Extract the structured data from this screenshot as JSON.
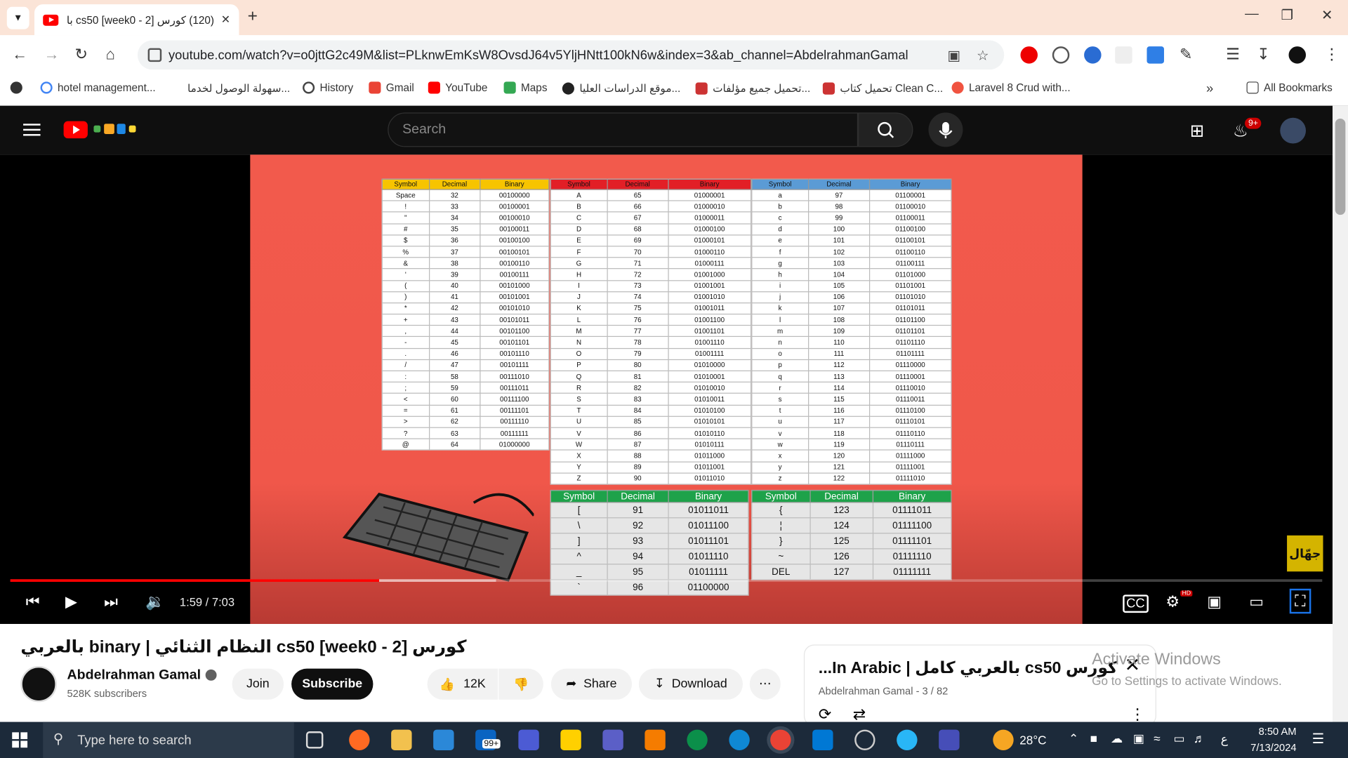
{
  "browser": {
    "tab_title": "(120) كورس cs50 [week0 - 2] بال",
    "url": "youtube.com/watch?v=o0jttG2c49M&list=PLknwEmKsW8OvsdJ64v5YljHNtt100kN6w&index=3&ab_channel=AbdelrahmanGamal",
    "bookmarks": [
      "hotel management...",
      "سهولة الوصول لخدما...",
      "History",
      "Gmail",
      "YouTube",
      "Maps",
      "موقع الدراسات العليا...",
      "تحميل جميع مؤلفات...",
      "تحميل كتاب Clean C...",
      "Laravel 8 Crud with..."
    ],
    "all_bookmarks_label": "All Bookmarks"
  },
  "youtube": {
    "search_placeholder": "Search",
    "notification_count": "9+",
    "hd_badge": "HD",
    "player": {
      "current_time": "1:59",
      "duration": "7:03",
      "time_display": "1:59 / 7:03",
      "played_fraction": 0.281,
      "loaded_fraction": 0.37,
      "watermark": "جهّال"
    },
    "video_title": "كورس cs50 [week0 - 2] النظام الثنائي | binary بالعربي",
    "channel": {
      "name": "Abdelrahman Gamal",
      "subscribers": "528K subscribers"
    },
    "buttons": {
      "join": "Join",
      "subscribe": "Subscribe",
      "likes": "12K",
      "share": "Share",
      "download": "Download"
    },
    "playlist": {
      "title": "كورس cs50 بالعربي كامل | In Arabic...",
      "subtitle": "Abdelrahman Gamal - 3 / 82"
    },
    "activate_windows": {
      "title": "Activate Windows",
      "subtitle": "Go to Settings to activate Windows."
    }
  },
  "ascii_tables": {
    "headers": [
      "Symbol",
      "Decimal",
      "Binary"
    ],
    "symbols_table": [
      [
        "Space",
        "32",
        "00100000"
      ],
      [
        "!",
        "33",
        "00100001"
      ],
      [
        "\"",
        "34",
        "00100010"
      ],
      [
        "#",
        "35",
        "00100011"
      ],
      [
        "$",
        "36",
        "00100100"
      ],
      [
        "%",
        "37",
        "00100101"
      ],
      [
        "&",
        "38",
        "00100110"
      ],
      [
        "'",
        "39",
        "00100111"
      ],
      [
        "(",
        "40",
        "00101000"
      ],
      [
        ")",
        "41",
        "00101001"
      ],
      [
        "*",
        "42",
        "00101010"
      ],
      [
        "+",
        "43",
        "00101011"
      ],
      [
        ",",
        "44",
        "00101100"
      ],
      [
        "-",
        "45",
        "00101101"
      ],
      [
        ".",
        "46",
        "00101110"
      ],
      [
        "/",
        "47",
        "00101111"
      ],
      [
        ":",
        "58",
        "00111010"
      ],
      [
        ";",
        "59",
        "00111011"
      ],
      [
        "<",
        "60",
        "00111100"
      ],
      [
        "=",
        "61",
        "00111101"
      ],
      [
        ">",
        "62",
        "00111110"
      ],
      [
        "?",
        "63",
        "00111111"
      ],
      [
        "@",
        "64",
        "01000000"
      ]
    ],
    "upper_table": [
      [
        "A",
        "65",
        "01000001"
      ],
      [
        "B",
        "66",
        "01000010"
      ],
      [
        "C",
        "67",
        "01000011"
      ],
      [
        "D",
        "68",
        "01000100"
      ],
      [
        "E",
        "69",
        "01000101"
      ],
      [
        "F",
        "70",
        "01000110"
      ],
      [
        "G",
        "71",
        "01000111"
      ],
      [
        "H",
        "72",
        "01001000"
      ],
      [
        "I",
        "73",
        "01001001"
      ],
      [
        "J",
        "74",
        "01001010"
      ],
      [
        "K",
        "75",
        "01001011"
      ],
      [
        "L",
        "76",
        "01001100"
      ],
      [
        "M",
        "77",
        "01001101"
      ],
      [
        "N",
        "78",
        "01001110"
      ],
      [
        "O",
        "79",
        "01001111"
      ],
      [
        "P",
        "80",
        "01010000"
      ],
      [
        "Q",
        "81",
        "01010001"
      ],
      [
        "R",
        "82",
        "01010010"
      ],
      [
        "S",
        "83",
        "01010011"
      ],
      [
        "T",
        "84",
        "01010100"
      ],
      [
        "U",
        "85",
        "01010101"
      ],
      [
        "V",
        "86",
        "01010110"
      ],
      [
        "W",
        "87",
        "01010111"
      ],
      [
        "X",
        "88",
        "01011000"
      ],
      [
        "Y",
        "89",
        "01011001"
      ],
      [
        "Z",
        "90",
        "01011010"
      ]
    ],
    "lower_table": [
      [
        "a",
        "97",
        "01100001"
      ],
      [
        "b",
        "98",
        "01100010"
      ],
      [
        "c",
        "99",
        "01100011"
      ],
      [
        "d",
        "100",
        "01100100"
      ],
      [
        "e",
        "101",
        "01100101"
      ],
      [
        "f",
        "102",
        "01100110"
      ],
      [
        "g",
        "103",
        "01100111"
      ],
      [
        "h",
        "104",
        "01101000"
      ],
      [
        "i",
        "105",
        "01101001"
      ],
      [
        "j",
        "106",
        "01101010"
      ],
      [
        "k",
        "107",
        "01101011"
      ],
      [
        "l",
        "108",
        "01101100"
      ],
      [
        "m",
        "109",
        "01101101"
      ],
      [
        "n",
        "110",
        "01101110"
      ],
      [
        "o",
        "111",
        "01101111"
      ],
      [
        "p",
        "112",
        "01110000"
      ],
      [
        "q",
        "113",
        "01110001"
      ],
      [
        "r",
        "114",
        "01110010"
      ],
      [
        "s",
        "115",
        "01110011"
      ],
      [
        "t",
        "116",
        "01110100"
      ],
      [
        "u",
        "117",
        "01110101"
      ],
      [
        "v",
        "118",
        "01110110"
      ],
      [
        "w",
        "119",
        "01110111"
      ],
      [
        "x",
        "120",
        "01111000"
      ],
      [
        "y",
        "121",
        "01111001"
      ],
      [
        "z",
        "122",
        "01111010"
      ]
    ],
    "brackets_table": [
      [
        "[",
        "91",
        "01011011"
      ],
      [
        "\\",
        "92",
        "01011100"
      ],
      [
        "]",
        "93",
        "01011101"
      ],
      [
        "^",
        "94",
        "01011110"
      ],
      [
        "_",
        "95",
        "01011111"
      ],
      [
        "`",
        "96",
        "01100000"
      ]
    ],
    "braces_table": [
      [
        "{",
        "123",
        "01111011"
      ],
      [
        "¦",
        "124",
        "01111100"
      ],
      [
        "}",
        "125",
        "01111101"
      ],
      [
        "~",
        "126",
        "01111110"
      ],
      [
        "DEL",
        "127",
        "01111111"
      ]
    ]
  },
  "taskbar": {
    "search_placeholder": "Type here to search",
    "temperature": "28°C",
    "time": "8:50 AM",
    "date": "7/13/2024",
    "lang": "ع",
    "badge": "99+",
    "colors": {
      "background": "#1c2a3a",
      "accent": "#0078d4"
    }
  },
  "colors": {
    "yt_red": "#ff0000",
    "symbols_header": "#f7c400",
    "upper_header": "#e21f26",
    "lower_header": "#5b9bd5",
    "extra_header": "#1ea24a",
    "frame_bg": "#f25a4c"
  }
}
